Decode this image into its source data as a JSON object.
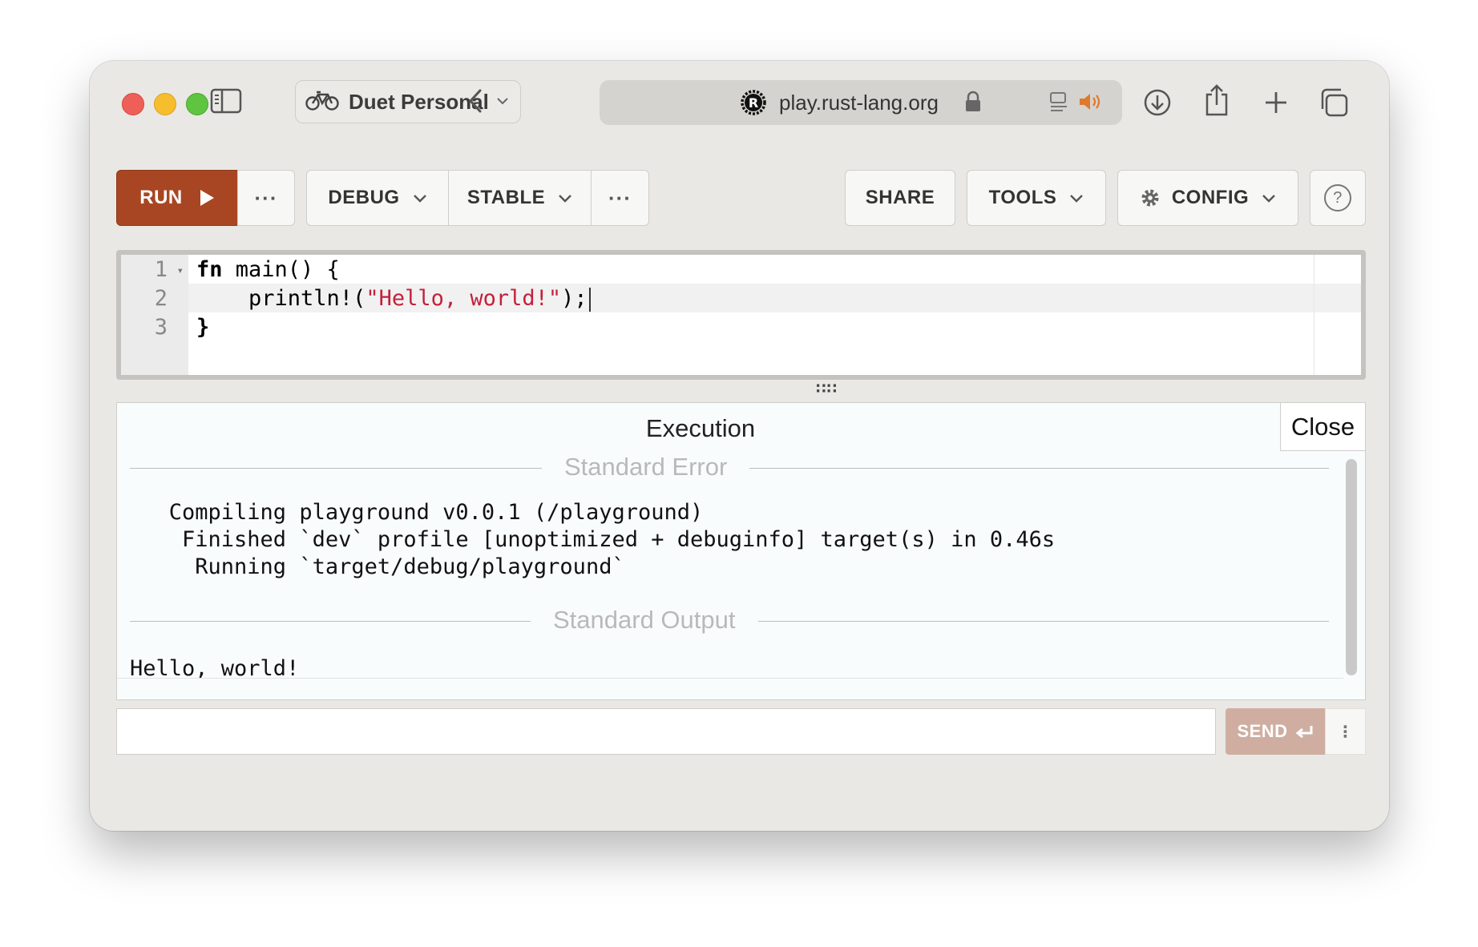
{
  "browser": {
    "profile_name": "Duet Personal",
    "url": "play.rust-lang.org"
  },
  "toolbar": {
    "run_label": "RUN",
    "more_label": "···",
    "debug_label": "DEBUG",
    "stable_label": "STABLE",
    "share_label": "SHARE",
    "tools_label": "TOOLS",
    "config_label": "CONFIG",
    "help_label": "?"
  },
  "editor": {
    "line_numbers": [
      "1",
      "2",
      "3"
    ],
    "lines": [
      {
        "kw": "fn",
        "rest": " main() {"
      },
      {
        "prefix": "    println!(",
        "str": "\"Hello, world!\"",
        "suffix": ");"
      },
      {
        "text": "}"
      }
    ]
  },
  "output": {
    "title": "Execution",
    "close_label": "Close",
    "stderr_label": "Standard Error",
    "stderr_lines": [
      "   Compiling playground v0.0.1 (/playground)",
      "    Finished `dev` profile [unoptimized + debuginfo] target(s) in 0.46s",
      "     Running `target/debug/playground`"
    ],
    "stdout_label": "Standard Output",
    "stdout_lines": [
      "Hello, world!"
    ]
  },
  "stdin": {
    "value": "",
    "send_label": "SEND"
  }
}
